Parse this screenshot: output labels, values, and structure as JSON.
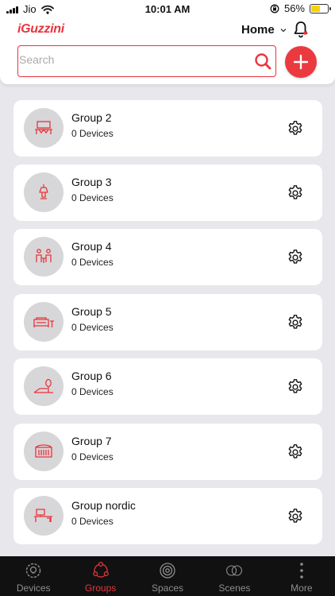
{
  "status_bar": {
    "carrier": "Jio",
    "time": "10:01 AM",
    "battery": "56%"
  },
  "header": {
    "logo": "iGuzzini",
    "home_label": "Home"
  },
  "search": {
    "placeholder": "Search"
  },
  "groups": [
    {
      "name": "Group 2",
      "devices": "0 Devices",
      "icon": "bedroom-icon"
    },
    {
      "name": "Group 3",
      "devices": "0 Devices",
      "icon": "lamp-icon"
    },
    {
      "name": "Group 4",
      "devices": "0 Devices",
      "icon": "meeting-icon"
    },
    {
      "name": "Group 5",
      "devices": "0 Devices",
      "icon": "sofa-icon"
    },
    {
      "name": "Group 6",
      "devices": "0 Devices",
      "icon": "garden-icon"
    },
    {
      "name": "Group 7",
      "devices": "0 Devices",
      "icon": "radiator-icon"
    },
    {
      "name": "Group nordic",
      "devices": "0 Devices",
      "icon": "desk-icon"
    }
  ],
  "tabs": [
    {
      "label": "Devices",
      "icon": "bulb-gear-icon",
      "active": false
    },
    {
      "label": "Groups",
      "icon": "groups-icon",
      "active": true
    },
    {
      "label": "Spaces",
      "icon": "spaces-icon",
      "active": false
    },
    {
      "label": "Scenes",
      "icon": "scenes-icon",
      "active": false
    },
    {
      "label": "More",
      "icon": "more-icon",
      "active": false
    }
  ],
  "colors": {
    "accent": "#e8343c",
    "background": "#e7e7ec",
    "tabbar": "#111111"
  }
}
